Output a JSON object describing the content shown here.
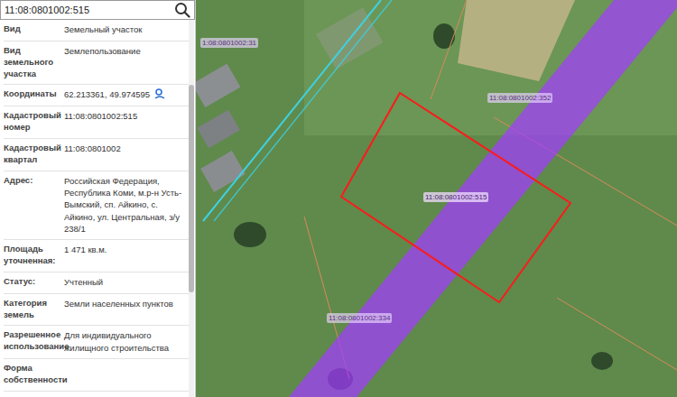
{
  "search": {
    "query": "11:08:0801002:515"
  },
  "info": {
    "rows": [
      {
        "label": "Вид",
        "value": "Земельный участок",
        "kind": "text"
      },
      {
        "label": "Вид земельного участка",
        "value": "Землепользование",
        "kind": "text"
      },
      {
        "label": "Координаты",
        "value": "62.213361, 49.974595",
        "kind": "coords"
      },
      {
        "label": "Кадастровый номер",
        "value": "11:08:0801002:515",
        "kind": "text"
      },
      {
        "label": "Кадастровый квартал",
        "value": "11:08:0801002",
        "kind": "text"
      },
      {
        "label": "Адрес:",
        "value": "Российская Федерация, Республика Коми, м.р-н Усть-Вымский, сп. Айкино, с. Айкино, ул. Центральная, з/у 238/1",
        "kind": "text"
      },
      {
        "label": "Площадь уточненная:",
        "value": "1 471 кв.м.",
        "kind": "text"
      },
      {
        "label": "Статус:",
        "value": "Учтенный",
        "kind": "text"
      },
      {
        "label": "Категория земель",
        "value": "Земли населенных пунктов",
        "kind": "text"
      },
      {
        "label": "Разрешенное использование",
        "value": "Для индивидуального жилищного строительства",
        "kind": "text"
      },
      {
        "label": "Форма собственности",
        "value": "",
        "kind": "text"
      }
    ]
  },
  "map": {
    "parcels": [
      {
        "label": "1:08:0801002:31",
        "selected": false
      },
      {
        "label": "11:08:0801002:352",
        "selected": false
      },
      {
        "label": "11:08:0801002:515",
        "selected": true
      },
      {
        "label": "11:08:0801002:334",
        "selected": false
      }
    ]
  }
}
